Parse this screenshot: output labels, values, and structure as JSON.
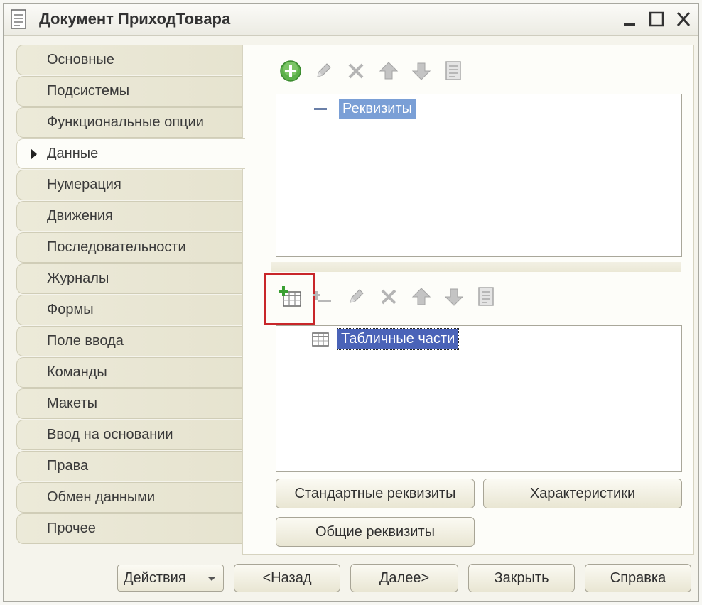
{
  "window": {
    "title": "Документ ПриходТовара"
  },
  "tabs": [
    {
      "label": "Основные"
    },
    {
      "label": "Подсистемы"
    },
    {
      "label": "Функциональные опции"
    },
    {
      "label": "Данные",
      "active": true
    },
    {
      "label": "Нумерация"
    },
    {
      "label": "Движения"
    },
    {
      "label": "Последовательности"
    },
    {
      "label": "Журналы"
    },
    {
      "label": "Формы"
    },
    {
      "label": "Поле ввода"
    },
    {
      "label": "Команды"
    },
    {
      "label": "Макеты"
    },
    {
      "label": "Ввод на основании"
    },
    {
      "label": "Права"
    },
    {
      "label": "Обмен данными"
    },
    {
      "label": "Прочее"
    }
  ],
  "attributes_toolbar": {
    "icons": [
      "add-icon",
      "edit-icon",
      "delete-icon",
      "move-up-icon",
      "move-down-icon",
      "list-icon"
    ]
  },
  "attributes_tree": {
    "node_label": "Реквизиты",
    "node_icon": "collapse-icon"
  },
  "tabular_toolbar": {
    "icons": [
      "add-tabular-part-icon",
      "add-column-icon",
      "edit-icon",
      "delete-icon",
      "move-up-icon",
      "move-down-icon",
      "list-icon"
    ]
  },
  "tabular_tree": {
    "node_label": "Табличные части",
    "node_icon": "table-icon"
  },
  "buttons": {
    "standard_attributes": "Стандартные реквизиты",
    "characteristics": "Характеристики",
    "common_attributes": "Общие реквизиты"
  },
  "footer": {
    "actions": "Действия",
    "back": "<Назад",
    "next": "Далее>",
    "close": "Закрыть",
    "help": "Справка"
  },
  "colors": {
    "highlight_box": "#c8262a",
    "selected_node": "#7a9fd6",
    "focused_node": "#4a63b8"
  }
}
